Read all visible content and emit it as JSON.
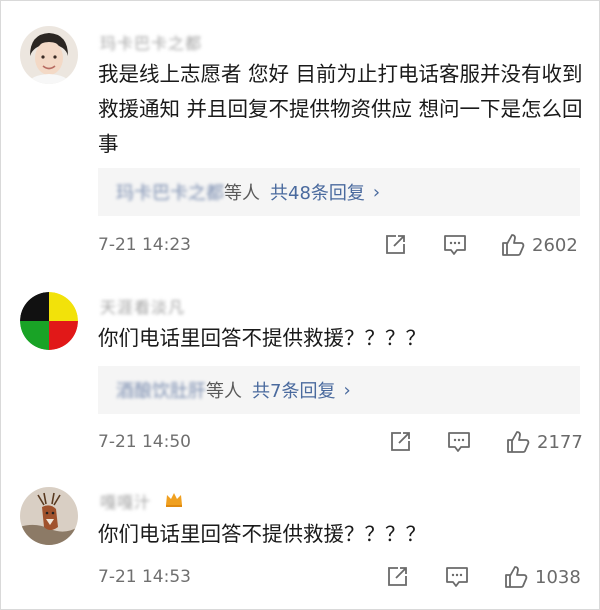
{
  "comments": [
    {
      "username": "玛卡巴卡之都",
      "text": "我是线上志愿者 您好 目前为止打电话客服并没有收到救援通知 并且回复不提供物资供应 想问一下是怎么回事",
      "reply_names": "玛卡巴卡之都",
      "reply_suffix": "等人",
      "reply_count": "共48条回复",
      "time": "7-21 14:23",
      "likes": "2602",
      "avatar": "person-photo"
    },
    {
      "username": "天涯看淡凡",
      "text": "你们电话里回答不提供救援？？？？",
      "reply_names": "酒酿饮肚肝",
      "reply_suffix": "等人",
      "reply_count": "共7条回复",
      "time": "7-21 14:50",
      "likes": "2177",
      "avatar": "four-color-circle"
    },
    {
      "username": "嘎嘎汁",
      "text": "你们电话里回答不提供救援？？？？",
      "time": "7-21 14:53",
      "likes": "1038",
      "avatar": "deer-photo"
    }
  ],
  "colors": {
    "link": "#4a6a9e",
    "muted": "#6f6f6f",
    "reply_bg": "#f5f5f5"
  },
  "icons": {
    "share": "share-icon",
    "comment": "comment-icon",
    "like": "thumbs-up-icon"
  }
}
